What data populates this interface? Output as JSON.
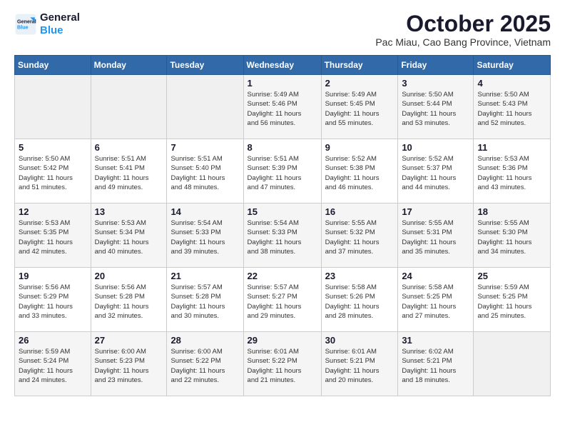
{
  "logo": {
    "line1": "General",
    "line2": "Blue"
  },
  "title": "October 2025",
  "subtitle": "Pac Miau, Cao Bang Province, Vietnam",
  "days_of_week": [
    "Sunday",
    "Monday",
    "Tuesday",
    "Wednesday",
    "Thursday",
    "Friday",
    "Saturday"
  ],
  "weeks": [
    [
      {
        "day": "",
        "info": ""
      },
      {
        "day": "",
        "info": ""
      },
      {
        "day": "",
        "info": ""
      },
      {
        "day": "1",
        "info": "Sunrise: 5:49 AM\nSunset: 5:46 PM\nDaylight: 11 hours\nand 56 minutes."
      },
      {
        "day": "2",
        "info": "Sunrise: 5:49 AM\nSunset: 5:45 PM\nDaylight: 11 hours\nand 55 minutes."
      },
      {
        "day": "3",
        "info": "Sunrise: 5:50 AM\nSunset: 5:44 PM\nDaylight: 11 hours\nand 53 minutes."
      },
      {
        "day": "4",
        "info": "Sunrise: 5:50 AM\nSunset: 5:43 PM\nDaylight: 11 hours\nand 52 minutes."
      }
    ],
    [
      {
        "day": "5",
        "info": "Sunrise: 5:50 AM\nSunset: 5:42 PM\nDaylight: 11 hours\nand 51 minutes."
      },
      {
        "day": "6",
        "info": "Sunrise: 5:51 AM\nSunset: 5:41 PM\nDaylight: 11 hours\nand 49 minutes."
      },
      {
        "day": "7",
        "info": "Sunrise: 5:51 AM\nSunset: 5:40 PM\nDaylight: 11 hours\nand 48 minutes."
      },
      {
        "day": "8",
        "info": "Sunrise: 5:51 AM\nSunset: 5:39 PM\nDaylight: 11 hours\nand 47 minutes."
      },
      {
        "day": "9",
        "info": "Sunrise: 5:52 AM\nSunset: 5:38 PM\nDaylight: 11 hours\nand 46 minutes."
      },
      {
        "day": "10",
        "info": "Sunrise: 5:52 AM\nSunset: 5:37 PM\nDaylight: 11 hours\nand 44 minutes."
      },
      {
        "day": "11",
        "info": "Sunrise: 5:53 AM\nSunset: 5:36 PM\nDaylight: 11 hours\nand 43 minutes."
      }
    ],
    [
      {
        "day": "12",
        "info": "Sunrise: 5:53 AM\nSunset: 5:35 PM\nDaylight: 11 hours\nand 42 minutes."
      },
      {
        "day": "13",
        "info": "Sunrise: 5:53 AM\nSunset: 5:34 PM\nDaylight: 11 hours\nand 40 minutes."
      },
      {
        "day": "14",
        "info": "Sunrise: 5:54 AM\nSunset: 5:33 PM\nDaylight: 11 hours\nand 39 minutes."
      },
      {
        "day": "15",
        "info": "Sunrise: 5:54 AM\nSunset: 5:33 PM\nDaylight: 11 hours\nand 38 minutes."
      },
      {
        "day": "16",
        "info": "Sunrise: 5:55 AM\nSunset: 5:32 PM\nDaylight: 11 hours\nand 37 minutes."
      },
      {
        "day": "17",
        "info": "Sunrise: 5:55 AM\nSunset: 5:31 PM\nDaylight: 11 hours\nand 35 minutes."
      },
      {
        "day": "18",
        "info": "Sunrise: 5:55 AM\nSunset: 5:30 PM\nDaylight: 11 hours\nand 34 minutes."
      }
    ],
    [
      {
        "day": "19",
        "info": "Sunrise: 5:56 AM\nSunset: 5:29 PM\nDaylight: 11 hours\nand 33 minutes."
      },
      {
        "day": "20",
        "info": "Sunrise: 5:56 AM\nSunset: 5:28 PM\nDaylight: 11 hours\nand 32 minutes."
      },
      {
        "day": "21",
        "info": "Sunrise: 5:57 AM\nSunset: 5:28 PM\nDaylight: 11 hours\nand 30 minutes."
      },
      {
        "day": "22",
        "info": "Sunrise: 5:57 AM\nSunset: 5:27 PM\nDaylight: 11 hours\nand 29 minutes."
      },
      {
        "day": "23",
        "info": "Sunrise: 5:58 AM\nSunset: 5:26 PM\nDaylight: 11 hours\nand 28 minutes."
      },
      {
        "day": "24",
        "info": "Sunrise: 5:58 AM\nSunset: 5:25 PM\nDaylight: 11 hours\nand 27 minutes."
      },
      {
        "day": "25",
        "info": "Sunrise: 5:59 AM\nSunset: 5:25 PM\nDaylight: 11 hours\nand 25 minutes."
      }
    ],
    [
      {
        "day": "26",
        "info": "Sunrise: 5:59 AM\nSunset: 5:24 PM\nDaylight: 11 hours\nand 24 minutes."
      },
      {
        "day": "27",
        "info": "Sunrise: 6:00 AM\nSunset: 5:23 PM\nDaylight: 11 hours\nand 23 minutes."
      },
      {
        "day": "28",
        "info": "Sunrise: 6:00 AM\nSunset: 5:22 PM\nDaylight: 11 hours\nand 22 minutes."
      },
      {
        "day": "29",
        "info": "Sunrise: 6:01 AM\nSunset: 5:22 PM\nDaylight: 11 hours\nand 21 minutes."
      },
      {
        "day": "30",
        "info": "Sunrise: 6:01 AM\nSunset: 5:21 PM\nDaylight: 11 hours\nand 20 minutes."
      },
      {
        "day": "31",
        "info": "Sunrise: 6:02 AM\nSunset: 5:21 PM\nDaylight: 11 hours\nand 18 minutes."
      },
      {
        "day": "",
        "info": ""
      }
    ]
  ]
}
